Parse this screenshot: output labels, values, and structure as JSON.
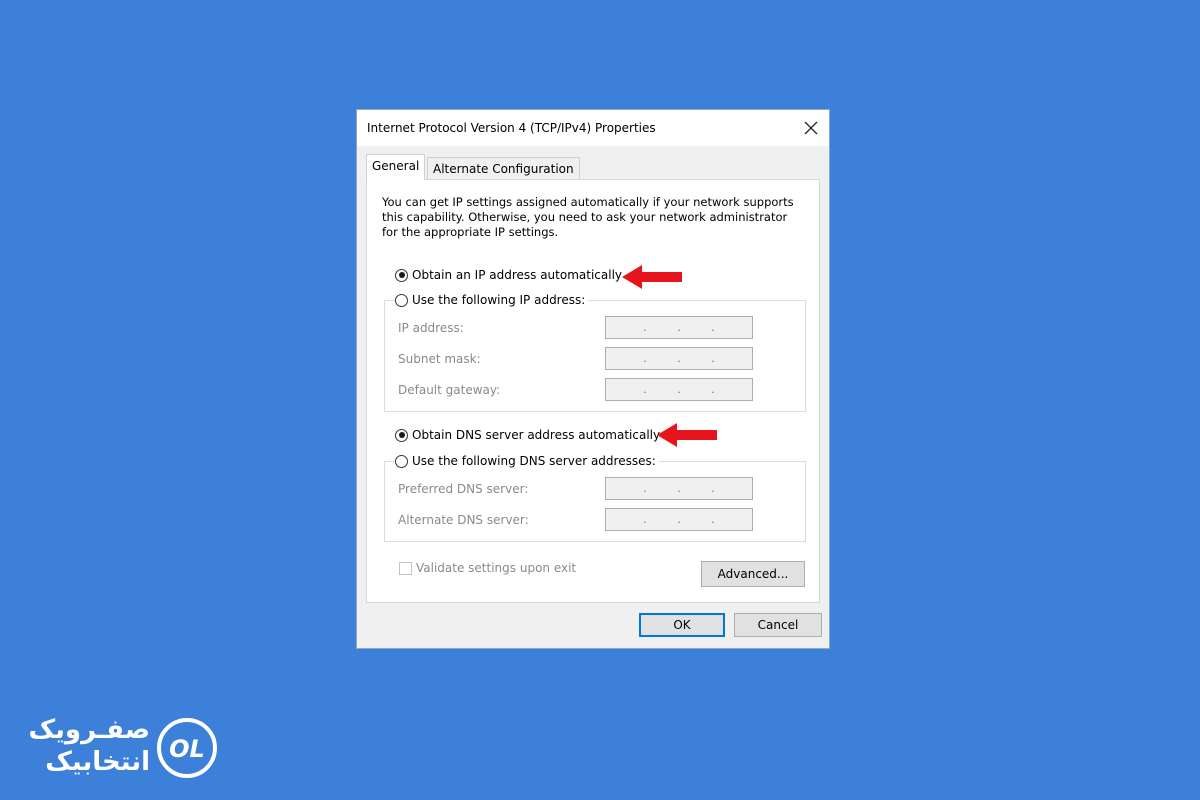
{
  "window": {
    "title": "Internet Protocol Version 4 (TCP/IPv4) Properties",
    "close_icon": "close-icon"
  },
  "tabs": [
    {
      "label": "General",
      "active": true
    },
    {
      "label": "Alternate Configuration",
      "active": false
    }
  ],
  "description": "You can get IP settings assigned automatically if your network supports this capability. Otherwise, you need to ask your network administrator for the appropriate IP settings.",
  "ip": {
    "auto_label": "Obtain an IP address automatically",
    "auto_selected": true,
    "manual_label": "Use the following IP address:",
    "manual_selected": false,
    "fields": [
      {
        "label": "IP address:",
        "value": ". . ."
      },
      {
        "label": "Subnet mask:",
        "value": ". . ."
      },
      {
        "label": "Default gateway:",
        "value": ". . ."
      }
    ]
  },
  "dns": {
    "auto_label": "Obtain DNS server address automatically",
    "auto_selected": true,
    "manual_label": "Use the following DNS server addresses:",
    "manual_selected": false,
    "fields": [
      {
        "label": "Preferred DNS server:",
        "value": ". . ."
      },
      {
        "label": "Alternate DNS server:",
        "value": ". . ."
      }
    ]
  },
  "validate": {
    "label": "Validate settings upon exit",
    "checked": false,
    "enabled": false
  },
  "buttons": {
    "advanced": "Advanced...",
    "ok": "OK",
    "cancel": "Cancel"
  },
  "annotations": {
    "arrow_color": "#e8141b"
  },
  "branding": {
    "line1": "صفـرویک",
    "line2": "انتخابیک",
    "monogram": "OL"
  },
  "colors": {
    "background": "#3d80d9",
    "accent": "#0078d7"
  }
}
